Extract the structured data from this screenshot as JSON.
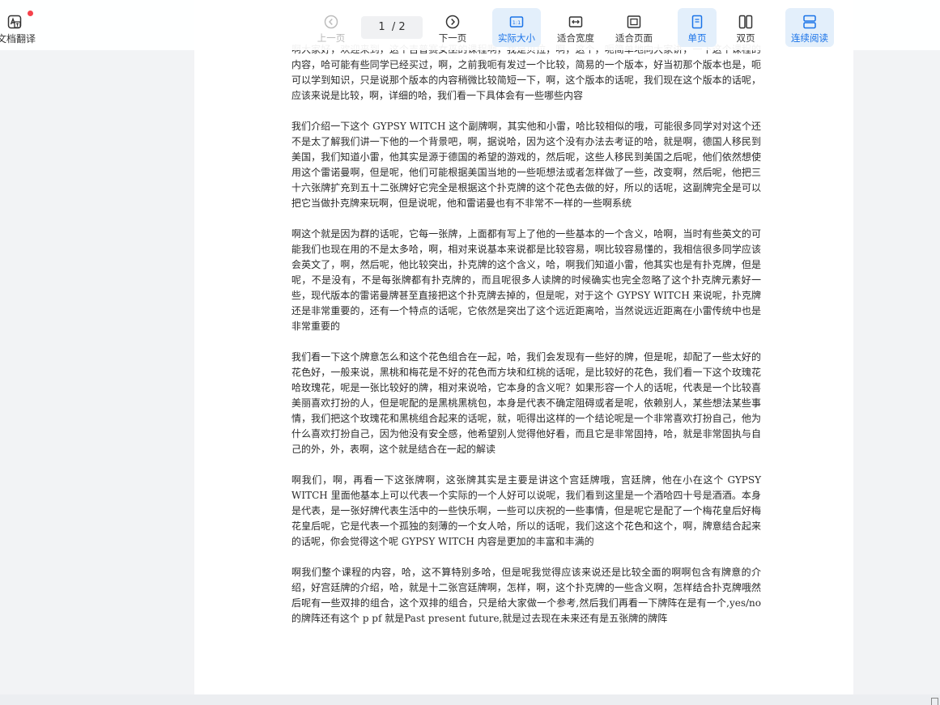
{
  "toolbar": {
    "translate_label": "文档翻译",
    "prev_label": "上一页",
    "next_label": "下一页",
    "current_page": "1",
    "total_pages": "/ 2",
    "actual_size_label": "实际大小",
    "fit_width_label": "适合宽度",
    "fit_page_label": "适合页面",
    "single_page_label": "单页",
    "double_page_label": "双页",
    "continuous_label": "连续阅读",
    "accent_color": "#1a73e8",
    "active_bg_color": "#e3effb",
    "notification_dot_color": "#f5424b"
  },
  "document": {
    "paragraphs": [
      "啊大家好，欢迎来到，这个吉普赛女巫的课程啊，我是贝拉，啊，这个，呃简单地向大家讲，一下这个课程的内容，哈可能有些同学已经买过，啊，之前我呃有发过一个比较，简易的一个版本，好当初那个版本也是，呃可以学到知识，只是说那个版本的内容稍微比较简短一下，啊，这个版本的话呢，我们现在这个版本的话呢，应该来说是比较，啊，详细的哈，我们看一下具体会有一些哪些内容",
      "我们介绍一下这个 GYPSY WITCH 这个副牌啊，其实他和小雷，哈比较相似的哦，可能很多同学对对这个还不是太了解我们讲一下他的一个背景吧，啊，据说哈，因为这个没有办法去考证的哈，就是啊，德国人移民到美国，我们知道小雷，他其实是源于德国的希望的游戏的，然后呢，这些人移民到美国之后呢，他们依然想使用这个雷诺曼啊，但是呢，他们可能根据美国当地的一些呃想法或者怎样做了一些，改变啊，然后呢，他把三十六张牌扩充到五十二张牌好它完全是根据这个扑克牌的这个花色去做的好，所以的话呢，这副牌完全是可以把它当做扑克牌来玩啊，但是说呢，他和雷诺曼也有不非常不一样的一些啊系统",
      "啊这个就是因为群的话呢，它每一张牌，上面都有写上了他的一些基本的一个含义，哈啊，当时有些英文的可能我们也现在用的不是太多哈，啊，相对来说基本来说都是比较容易，啊比较容易懂的，我相信很多同学应该会英文了，啊，然后呢，他比较突出，扑克牌的这个含义，哈，啊我们知道小雷，他其实也是有扑克牌，但是呢，不是没有，不是每张牌都有扑克牌的，而且呢很多人读牌的时候确实也完全忽略了这个扑克牌元素好一些，现代版本的雷诺曼牌甚至直接把这个扑克牌去掉的，但是呢，对于这个 GYPSY WITCH 来说呢，扑克牌还是非常重要的，还有一个特点的话呢，它依然是突出了这个远近距离哈，当然说远近距离在小雷传统中也是非常重要的",
      "我们看一下这个牌意怎么和这个花色组合在一起，哈，我们会发现有一些好的牌，但是呢，却配了一些太好的花色好，一般来说，黑桃和梅花是不好的花色而方块和红桃的话呢，是比较好的花色，我们看一下这个玫瑰花哈玫瑰花，呢是一张比较好的牌，相对来说哈，它本身的含义呢？如果形容一个人的话呢，代表是一个比较喜美丽喜欢打扮的人，但是呢配的是黑桃黑桃包，本身是代表不确定阻碍或者是呢，依赖别人，某些想法某些事情，我们把这个玫瑰花和黑桃组合起来的话呢，就，呃得出这样的一个结论呢是一个非常喜欢打扮自己，他为什么喜欢打扮自己，因为他没有安全感，他希望别人觉得他好看，而且它是非常固持，哈，就是非常固执与自己的外，外，表啊，这个就是结合在一起的解读",
      "啊我们，啊，再看一下这张牌啊，这张牌其实是主要是讲这个宫廷牌哦，宫廷牌，他在小在这个 GYPSY WITCH 里面他基本上可以代表一个实际的一个人好可以说呢，我们看到这里是一个酒哈四十号是酒酒。本身是代表，是一张好牌代表生活中的一些快乐啊，一些可以庆祝的一些事情，但是呢它是配了一个梅花皇后好梅花皇后呢，它是代表一个孤独的刻薄的一个女人哈，所以的话呢，我们这这个花色和这个，啊，牌意结合起来的话呢，你会觉得这个呢 GYPSY WITCH 内容是更加的丰富和丰满的",
      "啊我们整个课程的内容，哈，这不算特别多哈，但是呢我觉得应该来说还是比较全面的啊啊包含有牌意的介绍，好宫廷牌的介绍，哈，就是十二张宫廷牌啊，怎样，啊，这个扑克牌的一些含义啊，怎样结合扑克牌哦然后呢有一些双排的组合，这个双排的组合，只是给大家做一个参考,然后我们再看一下牌阵在是有一个,yes/no的牌阵还有这个 p pf 就是Past present future,就是过去现在未来还有是五张牌的牌阵"
    ]
  }
}
